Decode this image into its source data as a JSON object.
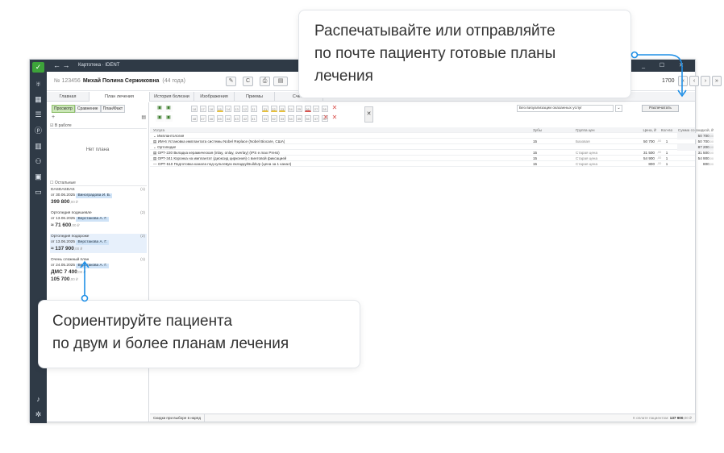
{
  "app": {
    "title": "Картотека · IDENT",
    "nav_back": "←",
    "nav_forward": "→",
    "window_controls": "_ ☐ ✕"
  },
  "sidebar_icons": [
    "check-logo-icon",
    "tooth-icon",
    "chart-icon",
    "list-icon",
    "ruble-icon",
    "bar-chart-icon",
    "people-icon",
    "calendar-icon",
    "chat-icon",
    "bell-icon",
    "gear-icon"
  ],
  "patient": {
    "id": "№ 123456",
    "name": "Михай Полина Сержиковна",
    "age": "(44 года)"
  },
  "toolbar": {
    "edit": "✎",
    "refresh": "C",
    "print": "⎙",
    "card": "▤",
    "counter": "1700",
    "first": "«",
    "prev": "‹",
    "next": "›",
    "last": "»",
    "menu": "⋯",
    "dropdown": "⌄"
  },
  "tabs": [
    "Главная",
    "План лечения",
    "История болезни",
    "Изображения",
    "Приемы",
    "Счета"
  ],
  "plan_view_tabs": [
    "Просмотр",
    "Сравнение",
    "План/Факт"
  ],
  "left_pane": {
    "add": "+",
    "in_work_header": "☑ В работе",
    "no_plan": "Нет плана",
    "others_header": "☐ Остальные",
    "plans": [
      {
        "name": "DASDASDAS",
        "count": "(1)",
        "date": "от 30.06.2025",
        "doctor": "Виноградова И. Б.",
        "sum": "399 800",
        "kop": ",00 ₽",
        "selected": false
      },
      {
        "name": "Ортопедия подешевле",
        "count": "(2)",
        "date": "от 13.06.2025",
        "doctor": "Верстакова А. Г.",
        "sum": "≈ 71 600",
        "kop": ",00 ₽",
        "selected": false
      },
      {
        "name": "Ортопедия подороже",
        "count": "(2)",
        "date": "от 13.06.2025",
        "doctor": "Верстакова А. Г.",
        "sum": "≈ 137 900",
        "kop": ",00 ₽",
        "selected": true
      },
      {
        "name": "Очень сложный план",
        "count": "(1)",
        "date": "от 24.05.2025",
        "doctor": "Верстакова А. Г.",
        "sum": "ДМС 7 400",
        "kop": ",00 ₽",
        "sum2": "105 700",
        "kop2": ",00 ₽",
        "selected": false
      }
    ]
  },
  "teeth": {
    "upper": [
      "18",
      "17",
      "16",
      "15",
      "14",
      "13",
      "12",
      "11",
      "21",
      "22",
      "23",
      "24",
      "25",
      "26",
      "27",
      "28"
    ],
    "lower": [
      "48",
      "47",
      "46",
      "45",
      "44",
      "43",
      "42",
      "41",
      "31",
      "32",
      "33",
      "34",
      "35",
      "36",
      "37",
      "38"
    ],
    "close": "✕"
  },
  "filter": {
    "value": "Без визуализации оказанных услуг",
    "arrow": "⌄"
  },
  "print_button": "Распечатать",
  "grid": {
    "headers": {
      "name": "Услуга",
      "teeth": "Зубы",
      "group": "Группа цен",
      "price": "Цена, ₽",
      "qty": "Кол-во",
      "sum": "Сумма со скидкой, ₽"
    },
    "rows": [
      {
        "type": "group",
        "name": "⌄ Имплантология",
        "sum": "50 700",
        "kop": ",00"
      },
      {
        "type": "item",
        "name": "▤ ИМ-6 Установка имплантата системы Nobel Replace (Nobel Biocare, США)",
        "teeth": "15",
        "group": "Базовая",
        "price": "50 700",
        "price_kop": ",00",
        "qty": "1",
        "sum": "50 700",
        "kop": ",00"
      },
      {
        "type": "group",
        "name": "⌄ Ортопедия",
        "sum": "87 200",
        "kop": ",00"
      },
      {
        "type": "item",
        "name": "▤ ОРТ-220 Вкладка керамическая (inlay, onlay, overlay) (IPS e.max Press)",
        "teeth": "15",
        "group": "Старая цена",
        "price": "31 500",
        "price_kop": ",00",
        "qty": "1",
        "sum": "31 500",
        "kop": ",00"
      },
      {
        "type": "item",
        "name": "▤ ОРТ-341 Коронка на имплантат (диоксид циркония) с винтовой фиксацией",
        "teeth": "15",
        "group": "Старая цена",
        "price": "54 900",
        "price_kop": ",00",
        "qty": "1",
        "sum": "54 900",
        "kop": ",00"
      },
      {
        "type": "item",
        "name": "— ОРТ-510 Подготовка канала под культевую вкладку/BuildUp (цена за 1 канал)",
        "teeth": "15",
        "group": "Старая цена",
        "price": "800",
        "price_kop": ",00",
        "qty": "1",
        "sum": "800",
        "kop": ",00"
      }
    ]
  },
  "footer": {
    "discounts": "Скидки при выборе в наряд",
    "to_pay_label": "К оплате пациентом:",
    "to_pay_value": "137 900",
    "to_pay_kop": ",00 ₽"
  },
  "callouts": {
    "top": [
      "Распечатывайте или отправляйте",
      "по почте пациенту готовые планы",
      "лечения"
    ],
    "bottom": [
      "Сориентируйте пациента",
      "по двум и более планам лечения"
    ],
    "accent": "#1f8fe6"
  }
}
